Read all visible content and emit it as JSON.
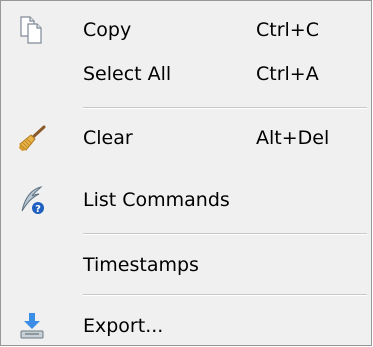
{
  "menu": {
    "items": [
      {
        "label": "Copy",
        "shortcut": "Ctrl+C",
        "icon": "copy-icon"
      },
      {
        "label": "Select All",
        "shortcut": "Ctrl+A"
      },
      {
        "label": "Clear",
        "shortcut": "Alt+Del",
        "icon": "broom-icon"
      },
      {
        "label": "List Commands",
        "icon": "quill-help-icon"
      },
      {
        "label": "Timestamps"
      },
      {
        "label": "Export...",
        "icon": "export-icon"
      }
    ]
  }
}
